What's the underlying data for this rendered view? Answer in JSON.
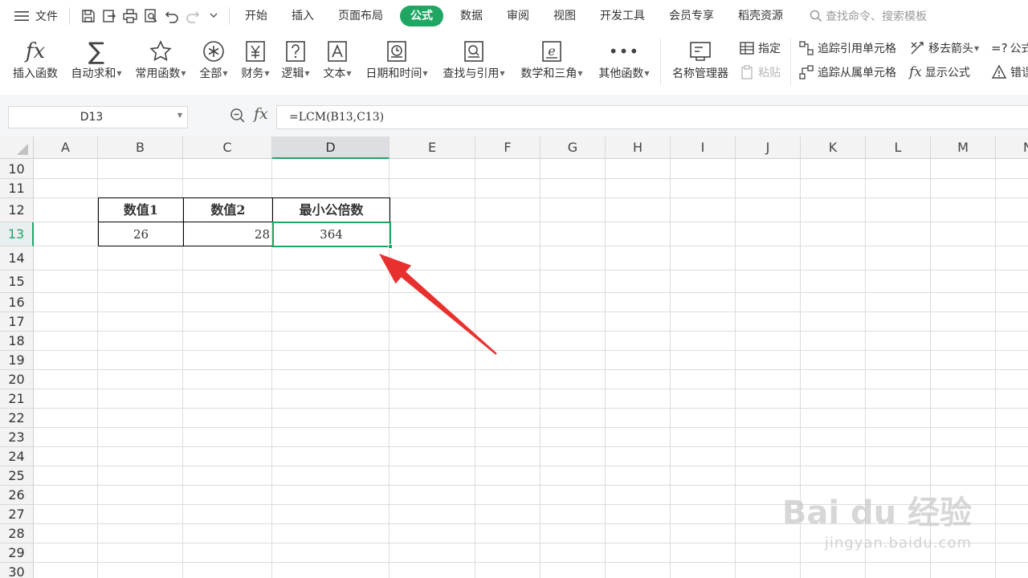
{
  "menubar": {
    "file_label": "文件",
    "tabs": [
      {
        "label": "开始"
      },
      {
        "label": "插入"
      },
      {
        "label": "页面布局"
      },
      {
        "label": "公式",
        "active": true
      },
      {
        "label": "数据"
      },
      {
        "label": "审阅"
      },
      {
        "label": "视图"
      },
      {
        "label": "开发工具"
      },
      {
        "label": "会员专享"
      },
      {
        "label": "稻壳资源"
      }
    ],
    "search_placeholder": "查找命令、搜索模板",
    "accent": "#1fa663"
  },
  "ribbon": {
    "insert_function": "插入函数",
    "autosum": "自动求和",
    "common": "常用函数",
    "all": "全部",
    "finance": "财务",
    "logic": "逻辑",
    "text": "文本",
    "datetime": "日期和时间",
    "lookup": "查找与引用",
    "math": "数学和三角",
    "other": "其他函数",
    "name_manager": "名称管理器",
    "specify": "指定",
    "paste": "粘贴",
    "trace_precedents": "追踪引用单元格",
    "trace_dependents": "追踪从属单元格",
    "remove_arrows": "移去箭头",
    "show_formulas": "显示公式",
    "formula_partial": "公式",
    "error_partial": "错误"
  },
  "formulabar": {
    "namebox": "D13",
    "formula": "=LCM(B13,C13)"
  },
  "sheet": {
    "columns": [
      "A",
      "B",
      "C",
      "D",
      "E",
      "F",
      "G",
      "H",
      "I",
      "J",
      "K",
      "L",
      "M",
      "N"
    ],
    "selected_column": "D",
    "rows": [
      "10",
      "11",
      "12",
      "13",
      "14",
      "15",
      "16",
      "17",
      "18",
      "19",
      "20",
      "21",
      "22",
      "23",
      "24",
      "25",
      "26",
      "27",
      "28",
      "29",
      "30"
    ],
    "selected_row": "13",
    "table": {
      "headers": [
        "数值1",
        "数值2",
        "最小公倍数"
      ],
      "values": [
        "26",
        "28",
        "364"
      ]
    }
  },
  "annotation": {
    "arrow_color": "#e8312f"
  },
  "watermark": {
    "title": "Bai du 经验",
    "url": "jingyan.baidu.com"
  }
}
